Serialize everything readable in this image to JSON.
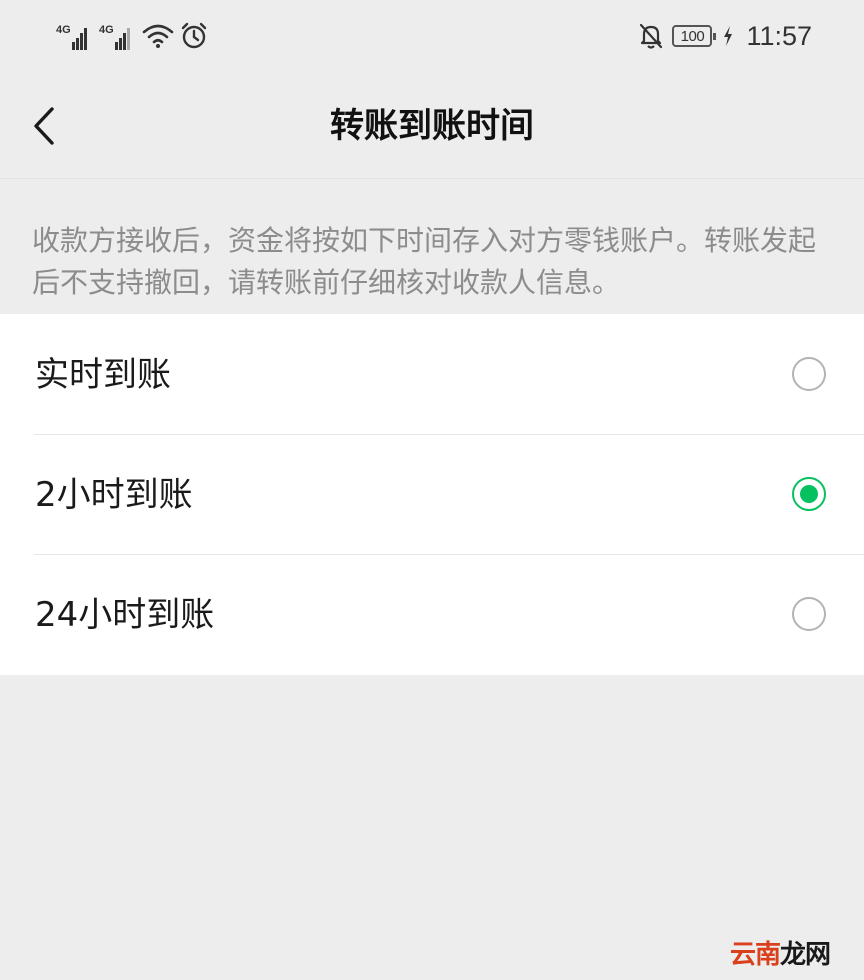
{
  "status_bar": {
    "network_1": "4G",
    "network_2": "4G",
    "battery": "100",
    "time": "11:57"
  },
  "nav": {
    "title": "转账到账时间"
  },
  "description": "收款方接收后，资金将按如下时间存入对方零钱账户。转账发起后不支持撤回，请转账前仔细核对收款人信息。",
  "options": [
    {
      "label": "实时到账",
      "selected": false
    },
    {
      "label": "2小时到账",
      "selected": true
    },
    {
      "label": "24小时到账",
      "selected": false
    }
  ],
  "colors": {
    "accent": "#07c160",
    "background": "#ededed",
    "card": "#ffffff",
    "secondary_text": "#8c8c8c"
  },
  "watermark": {
    "part1": "云南",
    "part2": "龙网"
  }
}
